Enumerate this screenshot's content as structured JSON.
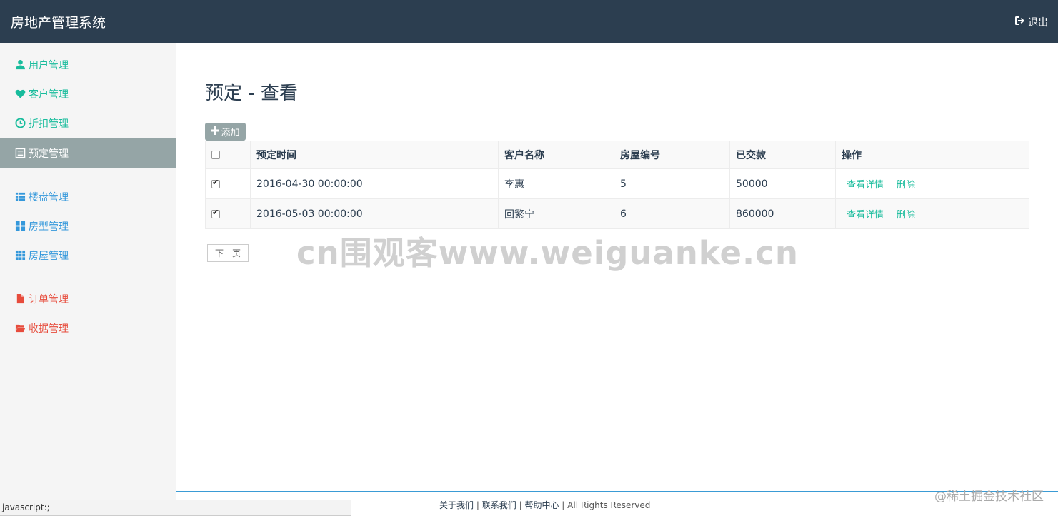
{
  "app": {
    "title": "房地产管理系统",
    "logout_label": "退出"
  },
  "sidebar": {
    "items": [
      {
        "label": "用户管理",
        "icon": "user-icon"
      },
      {
        "label": "客户管理",
        "icon": "heart-icon"
      },
      {
        "label": "折扣管理",
        "icon": "clock-icon"
      },
      {
        "label": "预定管理",
        "icon": "list-alt-icon"
      },
      {
        "label": "楼盘管理",
        "icon": "th-list-icon"
      },
      {
        "label": "房型管理",
        "icon": "th-large-icon"
      },
      {
        "label": "房屋管理",
        "icon": "th-icon"
      },
      {
        "label": "订单管理",
        "icon": "file-icon"
      },
      {
        "label": "收据管理",
        "icon": "folder-open-icon"
      }
    ]
  },
  "main": {
    "title": "预定 - 查看",
    "add_label": "添加",
    "table": {
      "headers": [
        "预定时间",
        "客户名称",
        "房屋编号",
        "已交款",
        "操作"
      ],
      "rows": [
        {
          "time": "2016-04-30 00:00:00",
          "customer": "李惠",
          "house": "5",
          "paid": "50000"
        },
        {
          "time": "2016-05-03 00:00:00",
          "customer": "回繁宁",
          "house": "6",
          "paid": "860000"
        }
      ],
      "actions": {
        "view": "查看详情",
        "delete": "删除"
      }
    },
    "next_page_label": "下一页"
  },
  "watermark": "cn围观客www.weiguanke.cn",
  "footer": {
    "about": "关于我们",
    "contact": "联系我们",
    "help": "帮助中心",
    "rights": "All Rights Reserved",
    "sep": "|",
    "juejin": "@稀土掘金技术社区"
  },
  "statusbar": "javascript:;",
  "colors": {
    "topbar": "#2c3e50",
    "accent_green": "#18bc9c",
    "accent_blue": "#3498db",
    "accent_red": "#e74c3c",
    "active_nav": "#95a5a6"
  }
}
